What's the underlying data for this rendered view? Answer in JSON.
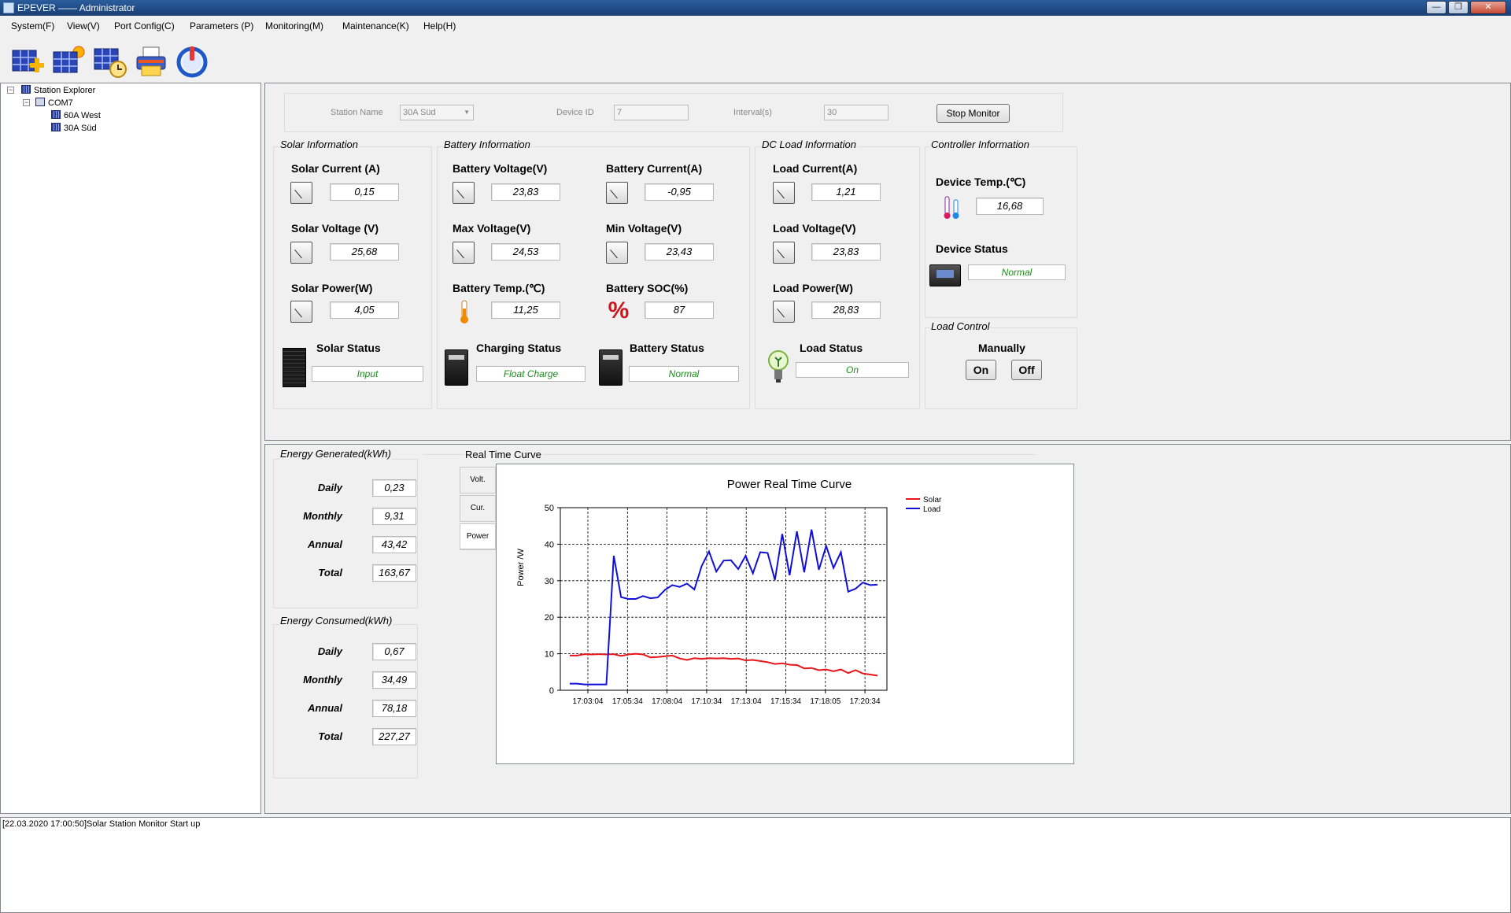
{
  "window": {
    "title": "EPEVER —— Administrator"
  },
  "menu": [
    "System(F)",
    "View(V)",
    "Port Config(C)",
    "Parameters (P)",
    "Monitoring(M)",
    "Maintenance(K)",
    "Help(H)"
  ],
  "toolbar": [
    "add-station-icon",
    "solar-station-icon",
    "station-clock-icon",
    "printer-icon",
    "power-icon"
  ],
  "explorer": {
    "root": "Station Explorer",
    "port": "COM7",
    "devices": [
      "60A West",
      "30A Süd"
    ]
  },
  "top": {
    "station_name_label": "Station Name",
    "station_name_value": "30A Süd",
    "device_id_label": "Device ID",
    "device_id_value": "7",
    "interval_label": "Interval(s)",
    "interval_value": "30",
    "stop_button": "Stop Monitor"
  },
  "solar": {
    "title": "Solar Information",
    "current_label": "Solar Current (A)",
    "current": "0,15",
    "voltage_label": "Solar Voltage (V)",
    "voltage": "25,68",
    "power_label": "Solar Power(W)",
    "power": "4,05",
    "status_label": "Solar Status",
    "status": "Input"
  },
  "battery": {
    "title": "Battery Information",
    "voltage_label": "Battery Voltage(V)",
    "voltage": "23,83",
    "current_label": "Battery Current(A)",
    "current": "-0,95",
    "max_label": "Max Voltage(V)",
    "max": "24,53",
    "min_label": "Min Voltage(V)",
    "min": "23,43",
    "temp_label": "Battery Temp.(℃)",
    "temp": "11,25",
    "soc_label": "Battery SOC(%)",
    "soc": "87",
    "charging_label": "Charging Status",
    "charging": "Float Charge",
    "status_label": "Battery Status",
    "status": "Normal"
  },
  "load": {
    "title": "DC Load Information",
    "current_label": "Load Current(A)",
    "current": "1,21",
    "voltage_label": "Load Voltage(V)",
    "voltage": "23,83",
    "power_label": "Load Power(W)",
    "power": "28,83",
    "status_label": "Load Status",
    "status": "On"
  },
  "controller": {
    "title": "Controller Information",
    "temp_label": "Device Temp.(℃)",
    "temp": "16,68",
    "status_label": "Device Status",
    "status": "Normal"
  },
  "load_control": {
    "title": "Load Control",
    "mode": "Manually",
    "on": "On",
    "off": "Off"
  },
  "energy_generated": {
    "title": "Energy Generated(kWh)",
    "rows": [
      {
        "label": "Daily",
        "value": "0,23"
      },
      {
        "label": "Monthly",
        "value": "9,31"
      },
      {
        "label": "Annual",
        "value": "43,42"
      },
      {
        "label": "Total",
        "value": "163,67"
      }
    ]
  },
  "energy_consumed": {
    "title": "Energy Consumed(kWh)",
    "rows": [
      {
        "label": "Daily",
        "value": "0,67"
      },
      {
        "label": "Monthly",
        "value": "34,49"
      },
      {
        "label": "Annual",
        "value": "78,18"
      },
      {
        "label": "Total",
        "value": "227,27"
      }
    ]
  },
  "curve": {
    "title": "Real Time Curve",
    "tabs": [
      "Volt.",
      "Cur.",
      "Power"
    ]
  },
  "colors": {
    "solar": "#e8141b",
    "load": "#1010d8",
    "status_green": "#1a8f1a"
  },
  "chart_data": {
    "type": "line",
    "title": "Power Real Time Curve",
    "ylabel": "Power /W",
    "xlabel": "",
    "ylim": [
      0,
      50
    ],
    "y_ticks": [
      0,
      10,
      20,
      30,
      40,
      50
    ],
    "x_ticks": [
      "17:03:04",
      "17:05:34",
      "17:08:04",
      "17:10:34",
      "17:13:04",
      "17:15:34",
      "17:18:05",
      "17:20:34"
    ],
    "grid": true,
    "legend": "top-right",
    "series": [
      {
        "name": "Solar",
        "color": "#e8141b",
        "values": [
          9.5,
          9.5,
          9.9,
          9.8,
          9.9,
          9.8,
          9.9,
          9.4,
          9.8,
          10.0,
          9.8,
          9.0,
          9.1,
          9.3,
          9.5,
          8.7,
          8.3,
          8.8,
          8.6,
          8.8,
          8.7,
          8.8,
          8.6,
          8.7,
          8.2,
          8.3,
          8.0,
          7.7,
          7.2,
          7.4,
          7.0,
          6.9,
          6.0,
          6.1,
          5.5,
          5.7,
          5.2,
          5.7,
          4.7,
          5.5,
          4.6,
          4.3,
          4.0
        ]
      },
      {
        "name": "Load",
        "color": "#1010d8",
        "values": [
          1.8,
          1.8,
          1.6,
          1.6,
          1.6,
          1.6,
          36.8,
          25.5,
          25.0,
          25.0,
          25.8,
          25.2,
          25.4,
          27.5,
          28.8,
          28.3,
          29.2,
          27.6,
          34.0,
          38.0,
          32.5,
          35.5,
          35.6,
          33.2,
          36.8,
          32.0,
          37.8,
          37.6,
          30.2,
          42.8,
          31.5,
          43.5,
          32.3,
          44.0,
          33.0,
          39.5,
          33.5,
          37.8,
          27.0,
          27.8,
          29.5,
          28.8,
          28.9
        ]
      }
    ]
  },
  "log": {
    "line": "[22.03.2020 17:00:50]Solar Station Monitor Start up"
  }
}
